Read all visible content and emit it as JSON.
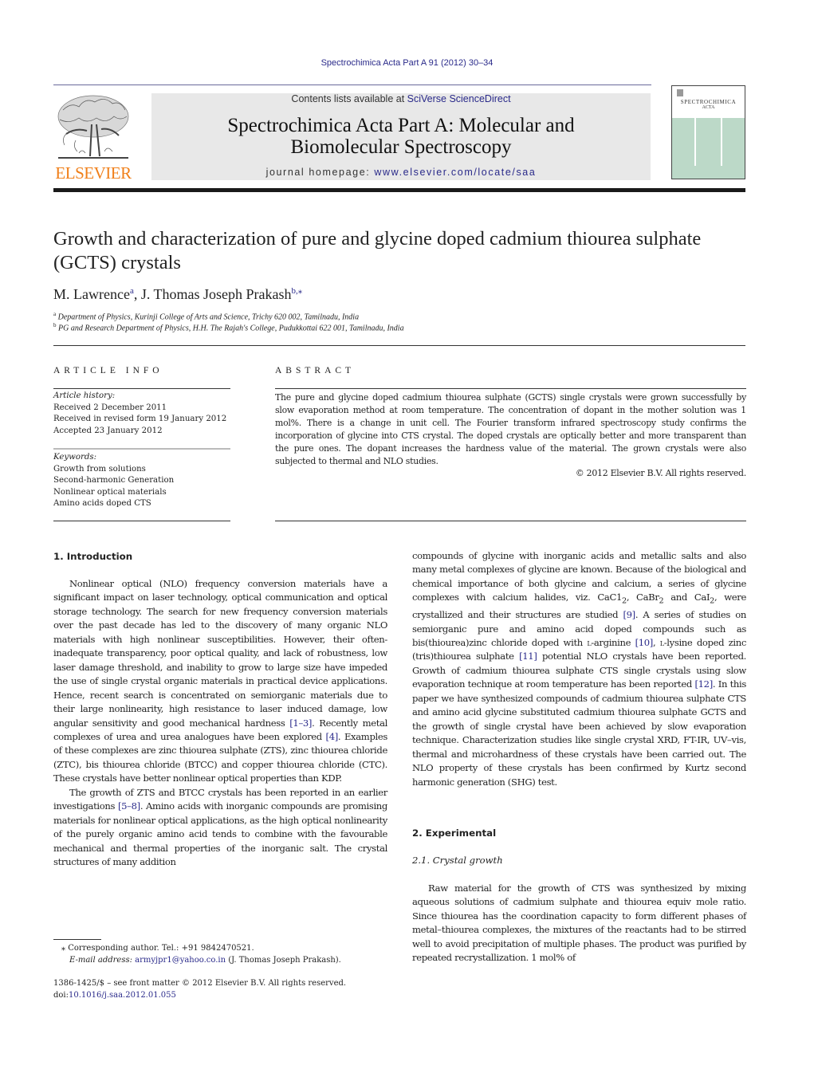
{
  "header": {
    "citation": "Spectrochimica Acta Part A 91 (2012) 30–34",
    "contents_prefix": "Contents lists available at ",
    "contents_link": "SciVerse ScienceDirect",
    "journal_title_line1": "Spectrochimica Acta Part A: Molecular and",
    "journal_title_line2": "Biomolecular Spectroscopy",
    "homepage_prefix": "journal homepage: ",
    "homepage_link": "www.elsevier.com/locate/saa",
    "publisher_logo_text": "ELSEVIER",
    "cover_title": "SPECTROCHIMICA",
    "cover_subtitle": "ACTA",
    "colors": {
      "publisher_orange": "#f07f19",
      "link_blue": "#2a2a8a",
      "cover_green": "#bcd9c8",
      "banner_grey": "#e8e8e8"
    }
  },
  "article": {
    "title": "Growth and characterization of pure and glycine doped cadmium thiourea sulphate (GCTS) crystals",
    "authors": [
      {
        "name": "M. Lawrence",
        "sup": "a"
      },
      {
        "name": "J. Thomas Joseph Prakash",
        "sup": "b,⁎"
      }
    ],
    "affiliations": [
      {
        "mark": "a",
        "text": "Department of Physics, Kurinji College of Arts and Science, Trichy 620 002, Tamilnadu, India"
      },
      {
        "mark": "b",
        "text": "PG and Research Department of Physics, H.H. The Rajah's College, Pudukkottai 622 001, Tamilnadu, India"
      }
    ]
  },
  "article_info": {
    "heading": "ARTICLE INFO",
    "history_label": "Article history:",
    "history": [
      "Received 2 December 2011",
      "Received in revised form 19 January 2012",
      "Accepted 23 January 2012"
    ],
    "keywords_label": "Keywords:",
    "keywords": [
      "Growth from solutions",
      "Second-harmonic Generation",
      "Nonlinear optical materials",
      "Amino acids doped CTS"
    ]
  },
  "abstract": {
    "heading": "ABSTRACT",
    "text": "The pure and glycine doped cadmium thiourea sulphate (GCTS) single crystals were grown successfully by slow evaporation method at room temperature. The concentration of dopant in the mother solution was 1 mol%. There is a change in unit cell. The Fourier transform infrared spectroscopy study confirms the incorporation of glycine into CTS crystal. The doped crystals are optically better and more transparent than the pure ones. The dopant increases the hardness value of the material. The grown crystals were also subjected to thermal and NLO studies.",
    "copyright": "© 2012 Elsevier B.V. All rights reserved."
  },
  "body": {
    "intro_heading": "1.  Introduction",
    "intro_p1": [
      "Nonlinear optical (NLO) frequency conversion materials have a significant impact on laser technology, optical communication and optical storage technology. The search for new frequency conversion materials over the past decade has led to the discovery of many organic NLO materials with high nonlinear susceptibilities. However, their often-inadequate transparency, poor optical quality, and lack of robustness, low laser damage threshold, and inability to grow to large size have impeded the use of single crystal organic materials in practical device applications. Hence, recent search is concentrated on semiorganic materials due to their large nonlinearity, high resistance to laser induced damage, low angular sensitivity and good mechanical hardness ",
      "[1–3]",
      ". Recently metal complexes of urea and urea analogues have been explored ",
      "[4]",
      ". Examples of these complexes are zinc thiourea sulphate (ZTS), zinc thiourea chloride (ZTC), bis thiourea chloride (BTCC) and copper thiourea chloride (CTC). These crystals have better nonlinear optical properties than KDP."
    ],
    "intro_p2": [
      "The growth of ZTS and BTCC crystals has been reported in an earlier investigations ",
      "[5–8]",
      ". Amino acids with inorganic compounds are promising materials for nonlinear optical applications, as the high optical nonlinearity of the purely organic amino acid tends to combine with the favourable mechanical and thermal properties of the inorganic salt. The crystal structures of many addition"
    ],
    "intro_p2_cont": {
      "a": "compounds of glycine with inorganic acids and metallic salts and also many metal complexes of glycine are known. Because of the biological and chemical importance of both glycine and calcium, a series of glycine complexes with calcium halides, viz. CaC1",
      "sub1": "2",
      "b": ", CaBr",
      "sub2": "2",
      "c": " and CaI",
      "sub3": "2",
      "d": ", were crystallized and their structures are studied ",
      "ref9": "[9]",
      "e": ". A series of studies on semiorganic pure and amino acid doped compounds such as bis(thiourea)zinc chloride doped with ",
      "l1": "l",
      "f": "-arginine ",
      "ref10": "[10]",
      "g": ", ",
      "l2": "l",
      "h": "-lysine doped zinc (tris)thiourea sulphate ",
      "ref11": "[11]",
      "i": " potential NLO crystals have been reported. Growth of cadmium thiourea sulphate CTS single crystals using slow evaporation technique at room temperature has been reported ",
      "ref12": "[12]",
      "j": ". In this paper we have synthesized compounds of cadmium thiourea sulphate CTS and amino acid glycine substituted cadmium thiourea sulphate GCTS and the growth of single crystal have been achieved by slow evaporation technique. Characterization studies like single crystal XRD, FT-IR, UV–vis, thermal and microhardness of these crystals have been carried out. The NLO property of these crystals has been confirmed by Kurtz second harmonic generation (SHG) test."
    },
    "exp_heading": "2.  Experimental",
    "exp_sub_heading": "2.1.  Crystal growth",
    "exp_p1": "Raw material for the growth of CTS was synthesized by mixing aqueous solutions of cadmium sulphate and thiourea equiv mole ratio. Since thiourea has the coordination capacity to form different phases of metal–thiourea complexes, the mixtures of the reactants had to be stirred well to avoid precipitation of multiple phases. The product was purified by repeated recrystallization. 1 mol% of"
  },
  "footnotes": {
    "star": "⁎",
    "corresponding": "Corresponding author. Tel.: +91 9842470521.",
    "email_label": "E-mail address: ",
    "email": "armyjpr1@yahoo.co.in",
    "email_suffix": " (J. Thomas Joseph Prakash).",
    "issn_line": "1386-1425/$ – see front matter © 2012 Elsevier B.V. All rights reserved.",
    "doi_prefix": "doi:",
    "doi": "10.1016/j.saa.2012.01.055"
  }
}
